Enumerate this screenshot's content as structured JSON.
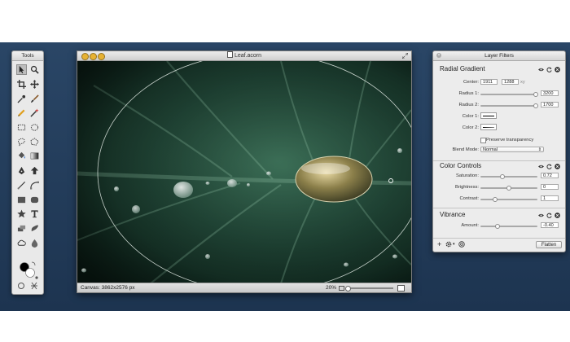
{
  "tools_palette": {
    "title": "Tools",
    "tools": [
      "select-icon",
      "zoom-icon",
      "crop-icon",
      "move-icon",
      "eyedropper-icon",
      "brush-icon",
      "pencil-icon",
      "magic-wand-icon",
      "rect-select-icon",
      "ellipse-select-icon",
      "lasso-icon",
      "polygon-lasso-icon",
      "fill-bucket-icon",
      "gradient-icon",
      "pen-icon",
      "arrow-icon",
      "line-icon",
      "shape-icon",
      "rect-shape-icon",
      "rounded-rect-icon",
      "star-icon",
      "text-icon",
      "clone-icon",
      "smudge-icon",
      "cloud-icon",
      "drop-icon"
    ],
    "bottom_tools": [
      "circle-tool-icon",
      "transform-icon"
    ]
  },
  "image_window": {
    "title": "Leaf.acorn",
    "status_canvas": "Canvas: 3862x2576 px",
    "zoom": "20%"
  },
  "layer_filters": {
    "title": "Layer Filters",
    "radial_gradient": {
      "heading": "Radial Gradient",
      "center_label": "Center:",
      "center_x": "1911",
      "center_y": "1288",
      "center_unit": "xy",
      "radius1_label": "Radius 1:",
      "radius1_value": "3200",
      "radius1_pos": 0.97,
      "radius2_label": "Radius 2:",
      "radius2_value": "1700",
      "radius2_pos": 0.97,
      "color1_label": "Color 1:",
      "color2_label": "Color 2:",
      "preserve_label": "Preserve transparency",
      "blend_label": "Blend Mode:",
      "blend_value": "Normal"
    },
    "color_controls": {
      "heading": "Color Controls",
      "saturation_label": "Saturation:",
      "saturation_value": "0.72",
      "saturation_pos": 0.38,
      "brightness_label": "Brightness:",
      "brightness_value": "0",
      "brightness_pos": 0.5,
      "contrast_label": "Contrast:",
      "contrast_value": "1",
      "contrast_pos": 0.25
    },
    "vibrance": {
      "heading": "Vibrance",
      "amount_label": "Amount:",
      "amount_value": "-0.40",
      "amount_pos": 0.3
    },
    "footer": {
      "add_label": "+",
      "flatten_label": "Flatten"
    }
  }
}
